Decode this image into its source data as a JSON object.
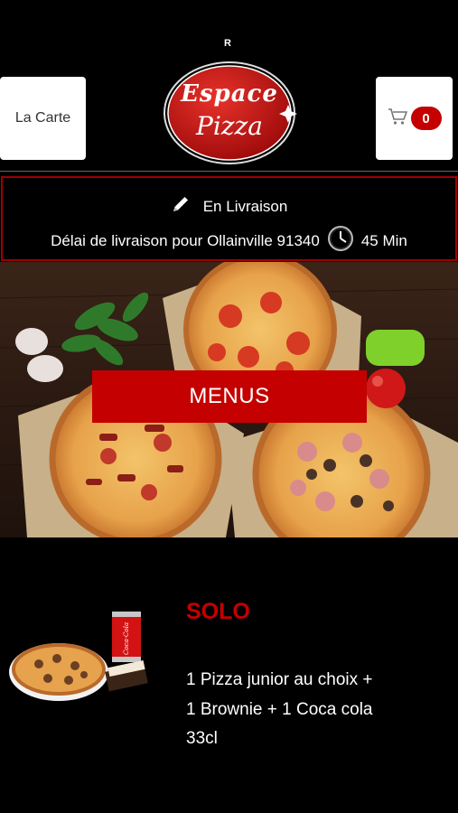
{
  "header": {
    "la_carte_label": "La Carte",
    "cart_count": "0",
    "registered_mark": "R",
    "logo_line1": "Espace",
    "logo_line2": "Pizza"
  },
  "delivery": {
    "mode_label": "En Livraison",
    "info_text": "Délai de livraison pour Ollainville 91340",
    "time_text": "45 Min"
  },
  "hero": {
    "button_label": "MENUS"
  },
  "menu": {
    "title": "SOLO",
    "description": "1 Pizza junior au choix  + 1 Brownie  + 1 Coca cola 33cl",
    "can_text": "Coca-Cola"
  },
  "colors": {
    "accent": "#c40000",
    "background": "#000000",
    "delivery_border": "#a00000"
  },
  "icons": {
    "edit": "pencil-icon",
    "clock": "clock-icon",
    "cart": "cart-icon"
  }
}
